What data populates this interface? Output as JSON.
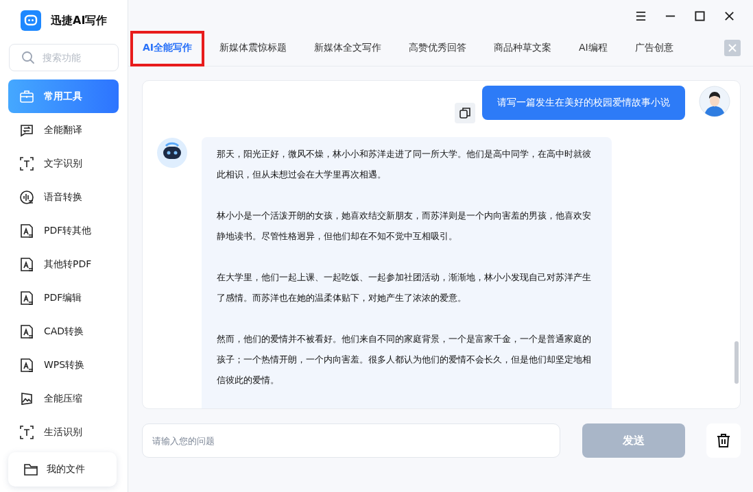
{
  "app": {
    "title": "迅捷AI写作"
  },
  "sidebar": {
    "search": {
      "placeholder": "搜索功能"
    },
    "items": [
      {
        "label": "常用工具",
        "kind": "toolbox",
        "selected": true
      },
      {
        "label": "全能翻译",
        "kind": "translate",
        "selected": false
      },
      {
        "label": "文字识别",
        "kind": "ocr",
        "selected": false
      },
      {
        "label": "语音转换",
        "kind": "voice",
        "selected": false
      },
      {
        "label": "PDF转其他",
        "kind": "doc",
        "selected": false
      },
      {
        "label": "其他转PDF",
        "kind": "doc",
        "selected": false
      },
      {
        "label": "PDF编辑",
        "kind": "doc",
        "selected": false
      },
      {
        "label": "CAD转换",
        "kind": "doc",
        "selected": false
      },
      {
        "label": "WPS转换",
        "kind": "doc",
        "selected": false
      },
      {
        "label": "全能压缩",
        "kind": "compress",
        "selected": false
      },
      {
        "label": "生活识别",
        "kind": "ocr",
        "selected": false
      }
    ],
    "footer": {
      "label": "我的文件"
    }
  },
  "tabs": [
    {
      "label": "AI全能写作",
      "selected": true,
      "highlighted": true
    },
    {
      "label": "新媒体震惊标题",
      "selected": false,
      "highlighted": false
    },
    {
      "label": "新媒体全文写作",
      "selected": false,
      "highlighted": false
    },
    {
      "label": "高赞优秀回答",
      "selected": false,
      "highlighted": false
    },
    {
      "label": "商品种草文案",
      "selected": false,
      "highlighted": false
    },
    {
      "label": "AI编程",
      "selected": false,
      "highlighted": false
    },
    {
      "label": "广告创意",
      "selected": false,
      "highlighted": false
    }
  ],
  "chat": [
    {
      "kind": "user",
      "text": "请写一篇发生在美好的校园爱情故事小说"
    },
    {
      "kind": "bot",
      "paragraphs": [
        "那天，阳光正好，微风不燥，林小小和苏洋走进了同一所大学。他们是高中同学，在高中时就彼此相识，但从未想过会在大学里再次相遇。",
        "林小小是一个活泼开朗的女孩，她喜欢结交新朋友，而苏洋则是一个内向害羞的男孩，他喜欢安静地读书。尽管性格迥异，但他们却在不知不觉中互相吸引。",
        "在大学里，他们一起上课、一起吃饭、一起参加社团活动，渐渐地，林小小发现自己对苏洋产生了感情。而苏洋也在她的温柔体贴下，对她产生了浓浓的爱意。",
        "然而，他们的爱情并不被看好。他们来自不同的家庭背景，一个是富家千金，一个是普通家庭的孩子；一个热情开朗，一个内向害羞。很多人都认为他们的爱情不会长久，但是他们却坚定地相信彼此的爱情。"
      ]
    }
  ],
  "input": {
    "placeholder": "请输入您的问题"
  },
  "send_button": {
    "label": "发送",
    "disabled": true
  }
}
